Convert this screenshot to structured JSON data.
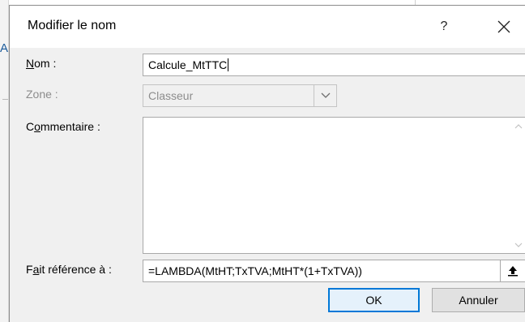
{
  "background": {
    "cell_fragment": "A"
  },
  "dialog": {
    "title": "Modifier le nom",
    "help_label": "?",
    "close_icon": "close-icon"
  },
  "fields": {
    "name": {
      "label_accel": "N",
      "label_rest": "om :",
      "value": "Calcule_MtTTC"
    },
    "zone": {
      "label": "Zone :",
      "value": "Classeur",
      "dropdown_icon": "chevron-down-icon"
    },
    "comment": {
      "label_pre": "C",
      "label_accel": "o",
      "label_rest": "mmentaire :",
      "value": ""
    },
    "refers_to": {
      "label_pre": "F",
      "label_accel": "a",
      "label_rest": "it référence à :",
      "value": "=LAMBDA(MtHT;TxTVA;MtHT*(1+TxTVA))",
      "collapse_icon": "collapse-dialog-icon"
    }
  },
  "buttons": {
    "ok": "OK",
    "cancel": "Annuler"
  }
}
